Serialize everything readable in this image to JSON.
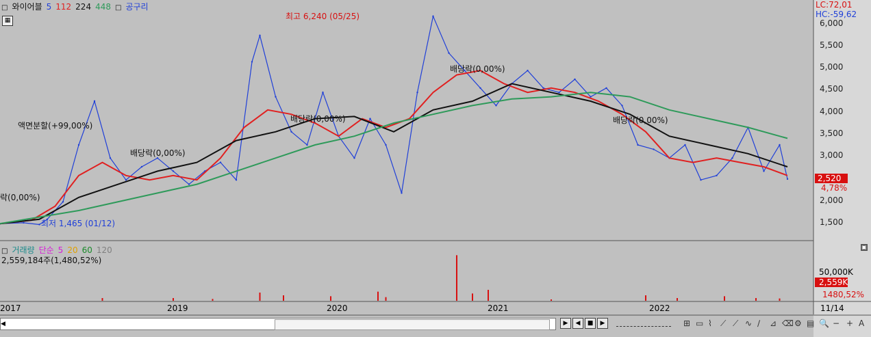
{
  "price_legend": {
    "name": "와이어블",
    "ma_labels": [
      {
        "text": "5",
        "color": "#1f3fd8"
      },
      {
        "text": "112",
        "color": "#e02020"
      },
      {
        "text": "224",
        "color": "#111111"
      },
      {
        "text": "448",
        "color": "#2e9a5a"
      },
      {
        "text": "공구리",
        "color": "#1f3fd8"
      }
    ]
  },
  "lc_text": "LC:72,01",
  "hc_text": "HC:-59,62",
  "price_axis_ticks": [
    "6,000",
    "5,500",
    "5,000",
    "4,500",
    "4,000",
    "3,500",
    "3,000",
    "2,500",
    "2,000",
    "1,500"
  ],
  "current_price_badge": "2,520",
  "current_change_pct": "4,78%",
  "annotations": {
    "high": "최고 6,240 (05/25)",
    "low": "최저 1,465 (01/12)",
    "split": "액면분할(+99,00%)",
    "div1": "배당락(0,00%)",
    "div2": "배당락(0,00%)",
    "div3": "배당락(0,00%)",
    "div4": "배당락(0,00%)",
    "edge": "락(0,00%)"
  },
  "volume_legend": {
    "title": "거래량",
    "type": "단순",
    "periods": [
      {
        "text": "5",
        "color": "#d81ad8"
      },
      {
        "text": "20",
        "color": "#e0a000"
      },
      {
        "text": "60",
        "color": "#1a8a2a"
      },
      {
        "text": "120",
        "color": "#808080"
      }
    ],
    "summary": "2,559,184주(1,480,52%)"
  },
  "volume_axis": {
    "tick": "50,000K",
    "badge": "2,559K",
    "pct": "1480,52%"
  },
  "date_axis": {
    "labels": [
      "2017",
      "2019",
      "2020",
      "2021",
      "2022"
    ],
    "right_label": "11/14"
  },
  "toolbar_icons": [
    "play-icon",
    "prev-icon",
    "stop-icon",
    "next-icon",
    "zoom-out-icon",
    "zoom-in-icon"
  ],
  "chart_data": {
    "type": "line",
    "title": "와이어블",
    "ylim": [
      1300,
      6300
    ],
    "x_range": [
      0,
      100
    ],
    "series": [
      {
        "name": "5",
        "color": "#1f3fd8",
        "x": [
          0,
          3,
          5,
          6,
          8,
          10,
          12,
          14,
          16,
          18,
          20,
          22,
          24,
          26,
          28,
          30,
          32,
          33,
          35,
          37,
          39,
          41,
          43,
          45,
          47,
          49,
          51,
          53,
          55,
          57,
          59,
          61,
          63,
          65,
          67,
          69,
          71,
          73,
          75,
          77,
          79,
          81,
          83,
          85,
          87,
          89,
          91,
          93,
          95,
          97,
          99,
          100
        ],
        "y": [
          1500,
          1520,
          1480,
          1600,
          2000,
          3300,
          4300,
          3000,
          2500,
          2800,
          3000,
          2700,
          2400,
          2700,
          2900,
          2500,
          5200,
          5800,
          4400,
          3600,
          3300,
          4500,
          3500,
          3000,
          3900,
          3300,
          2200,
          4500,
          6240,
          5400,
          5000,
          4600,
          4200,
          4700,
          5000,
          4600,
          4500,
          4800,
          4400,
          4600,
          4200,
          3300,
          3200,
          3000,
          3300,
          2500,
          2600,
          3000,
          3700,
          2700,
          3300,
          2520
        ]
      },
      {
        "name": "112",
        "color": "#e02020",
        "x": [
          0,
          4,
          7,
          10,
          13,
          16,
          19,
          22,
          25,
          28,
          31,
          34,
          37,
          40,
          43,
          46,
          49,
          52,
          55,
          58,
          61,
          64,
          67,
          70,
          73,
          76,
          79,
          82,
          85,
          88,
          91,
          94,
          97,
          100
        ],
        "y": [
          1500,
          1580,
          1900,
          2600,
          2900,
          2600,
          2500,
          2600,
          2500,
          3000,
          3700,
          4100,
          4000,
          3800,
          3500,
          3900,
          3700,
          3900,
          4500,
          4900,
          5000,
          4700,
          4500,
          4600,
          4500,
          4300,
          4000,
          3600,
          3000,
          2900,
          3000,
          2900,
          2800,
          2600
        ]
      },
      {
        "name": "224",
        "color": "#111111",
        "x": [
          0,
          5,
          10,
          15,
          20,
          25,
          30,
          35,
          40,
          45,
          50,
          55,
          60,
          65,
          70,
          75,
          80,
          85,
          90,
          95,
          100
        ],
        "y": [
          1500,
          1600,
          2100,
          2400,
          2700,
          2900,
          3400,
          3600,
          3900,
          3950,
          3600,
          4100,
          4300,
          4700,
          4500,
          4300,
          4000,
          3500,
          3300,
          3100,
          2800
        ]
      },
      {
        "name": "448",
        "color": "#2e9a5a",
        "x": [
          0,
          10,
          20,
          25,
          30,
          35,
          40,
          45,
          50,
          55,
          60,
          65,
          70,
          75,
          80,
          85,
          90,
          95,
          100
        ],
        "y": [
          1500,
          1800,
          2200,
          2400,
          2700,
          3000,
          3300,
          3500,
          3800,
          4000,
          4200,
          4350,
          4400,
          4500,
          4400,
          4100,
          3900,
          3700,
          3450
        ]
      }
    ],
    "volume": {
      "x": [
        13,
        22,
        27,
        33,
        36,
        42,
        48,
        49,
        58,
        60,
        62,
        70,
        82,
        86,
        92,
        96,
        99
      ],
      "values": [
        3000,
        3000,
        2000,
        9000,
        6000,
        5000,
        10000,
        4000,
        50000,
        8000,
        12000,
        1500,
        6000,
        3000,
        5000,
        3000,
        2559
      ]
    }
  }
}
